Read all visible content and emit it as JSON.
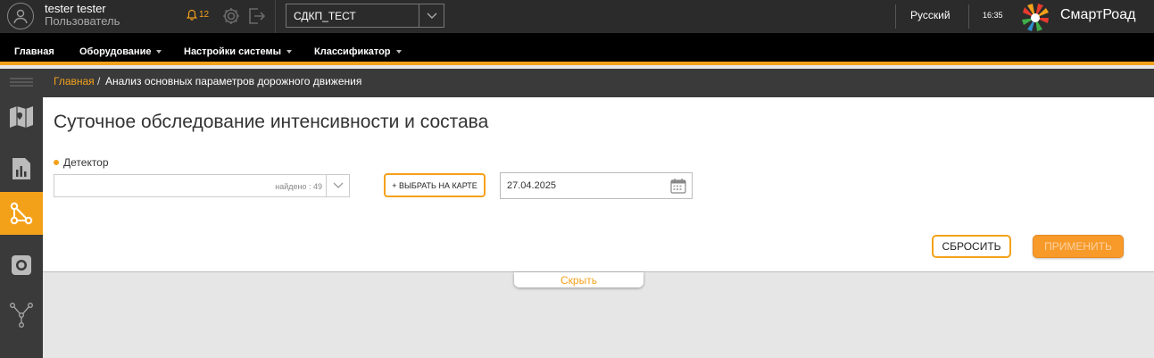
{
  "header": {
    "user_name": "tester tester",
    "user_role": "Пользователь",
    "notifications": "12",
    "system_select": "СДКП_ТЕСТ",
    "language": "Русский",
    "time": "16:35",
    "brand": "СмартРоад"
  },
  "menu": [
    {
      "label": "Главная"
    },
    {
      "label": "Оборудование"
    },
    {
      "label": "Настройки системы"
    },
    {
      "label": "Классификатор"
    }
  ],
  "breadcrumb": {
    "home": "Главная",
    "separator": "/",
    "current": "Анализ основных параметров дорожного движения"
  },
  "page": {
    "title": "Суточное обследование интенсивности и состава",
    "detector_label": "Детектор",
    "detector_found": "найдено : 49",
    "select_on_map": "+ ВЫБРАТЬ НА КАРТЕ",
    "date": "27.04.2025",
    "reset": "СБРОСИТЬ",
    "apply": "ПРИМЕНИТЬ",
    "hide": "Скрыть"
  },
  "colors": {
    "accent": "#f4a11a",
    "topbar": "#2b2b2b",
    "menubar": "#000000",
    "sidebar": "#3a3a3a"
  },
  "sidebar_icons": [
    "menu-lines-icon",
    "map-icon",
    "report-chart-icon",
    "route-nodes-icon",
    "camera-device-icon",
    "network-nodes-icon"
  ]
}
